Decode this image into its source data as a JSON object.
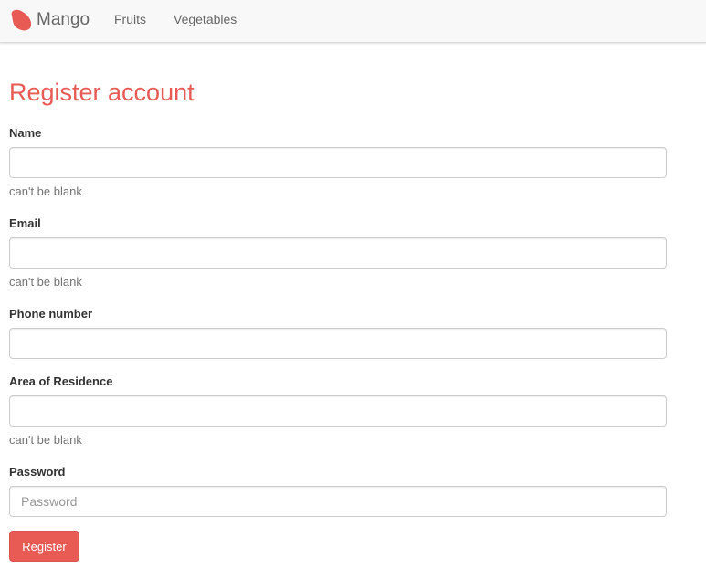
{
  "navbar": {
    "brand": "Mango",
    "brand_icon": "mango-logo-icon",
    "links": [
      "Fruits",
      "Vegetables"
    ]
  },
  "form": {
    "title": "Register account",
    "fields": [
      {
        "label": "Name",
        "value": "",
        "placeholder": "",
        "error": "can't be blank"
      },
      {
        "label": "Email",
        "value": "",
        "placeholder": "",
        "error": "can't be blank"
      },
      {
        "label": "Phone number",
        "value": "",
        "placeholder": "",
        "error": ""
      },
      {
        "label": "Area of Residence",
        "value": "",
        "placeholder": "",
        "error": "can't be blank"
      },
      {
        "label": "Password",
        "value": "",
        "placeholder": "Password",
        "error": ""
      }
    ],
    "submit_label": "Register"
  },
  "colors": {
    "accent": "#e85a54",
    "navbar_bg": "#f8f8f8",
    "help_text": "#737373"
  }
}
